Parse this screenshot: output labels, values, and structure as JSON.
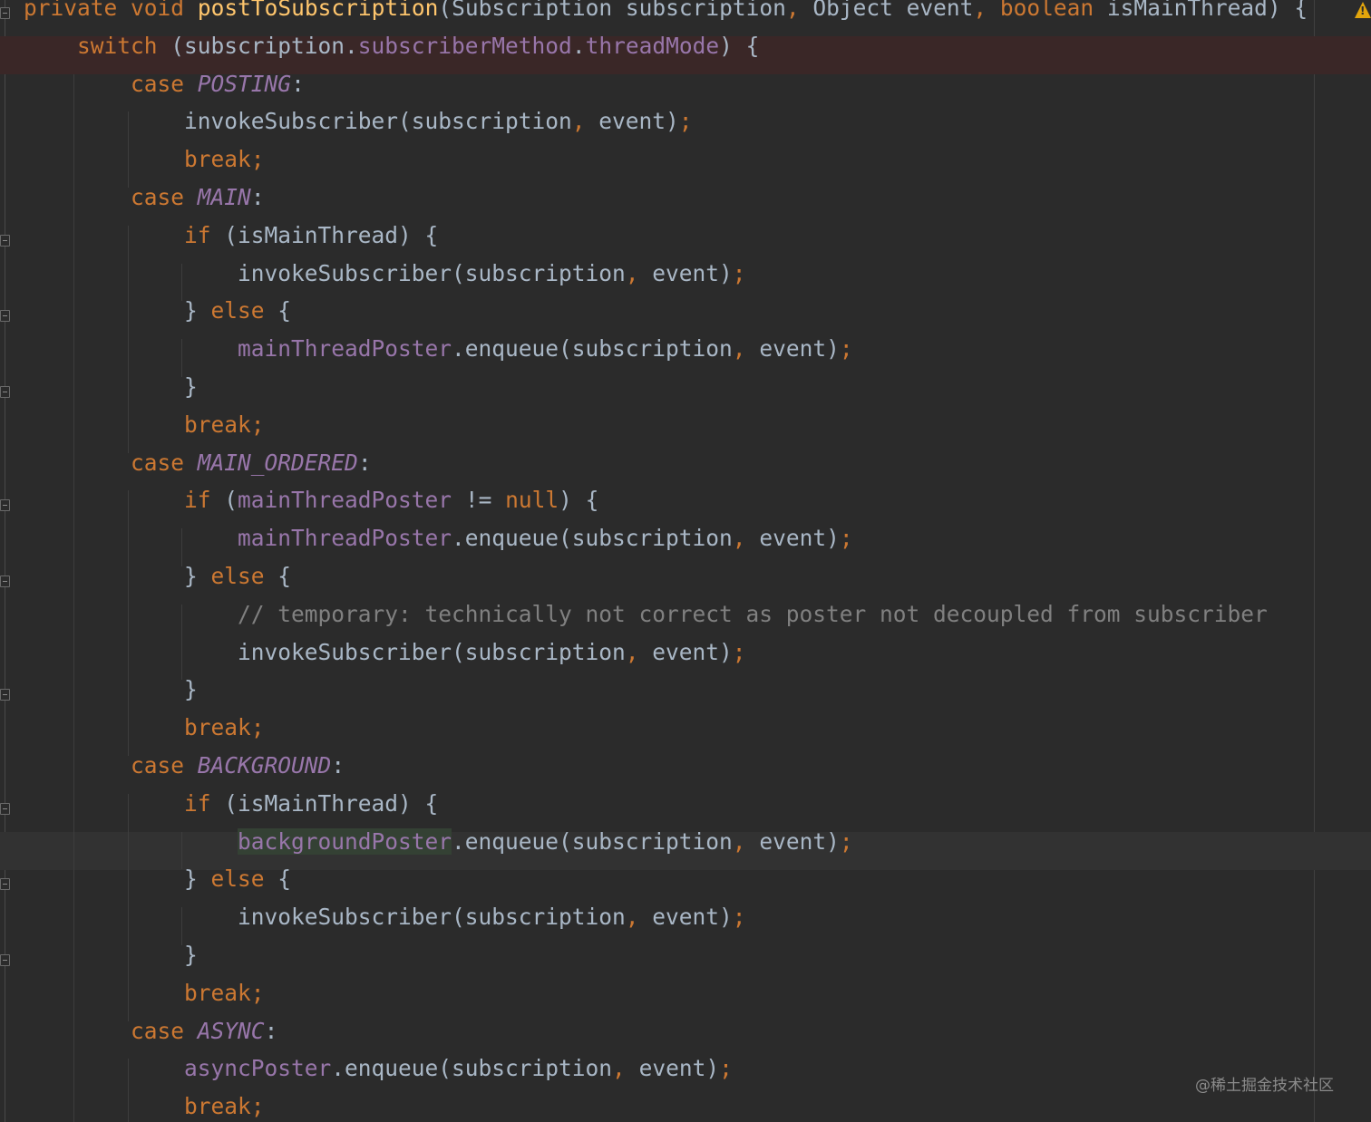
{
  "editor": {
    "language": "java",
    "theme": "darcula",
    "colors": {
      "background": "#2b2b2b",
      "keyword": "#cc7832",
      "function": "#ffc66d",
      "field": "#9876aa",
      "comment": "#808080",
      "text": "#a9b7c6",
      "error_line": "#3a2727",
      "warning": "#e2a50c"
    },
    "warning_icon": "warning-triangle-icon",
    "warning_glyph": "!",
    "watermark": "@稀土掘金技术社区",
    "lines": [
      [
        {
          "t": "kw",
          "v": "private"
        },
        {
          "t": "plain",
          "v": " "
        },
        {
          "t": "kw",
          "v": "void"
        },
        {
          "t": "plain",
          "v": " "
        },
        {
          "t": "fn",
          "v": "postToSubscription"
        },
        {
          "t": "plain",
          "v": "(Subscription subscription"
        },
        {
          "t": "punc",
          "v": ","
        },
        {
          "t": "plain",
          "v": " Object event"
        },
        {
          "t": "punc",
          "v": ","
        },
        {
          "t": "plain",
          "v": " "
        },
        {
          "t": "kw",
          "v": "boolean"
        },
        {
          "t": "plain",
          "v": " isMainThread) {"
        }
      ],
      [
        {
          "t": "plain",
          "v": "    "
        },
        {
          "t": "kw",
          "v": "switch"
        },
        {
          "t": "plain",
          "v": " (subscription."
        },
        {
          "t": "fld",
          "v": "subscriberMethod"
        },
        {
          "t": "plain",
          "v": "."
        },
        {
          "t": "fld",
          "v": "threadMode"
        },
        {
          "t": "plain",
          "v": ") {"
        }
      ],
      [
        {
          "t": "plain",
          "v": "        "
        },
        {
          "t": "kw",
          "v": "case"
        },
        {
          "t": "plain",
          "v": " "
        },
        {
          "t": "enum",
          "v": "POSTING"
        },
        {
          "t": "plain",
          "v": ":"
        }
      ],
      [
        {
          "t": "plain",
          "v": "            invokeSubscriber(subscription"
        },
        {
          "t": "punc",
          "v": ","
        },
        {
          "t": "plain",
          "v": " event)"
        },
        {
          "t": "punc",
          "v": ";"
        }
      ],
      [
        {
          "t": "plain",
          "v": "            "
        },
        {
          "t": "kw",
          "v": "break;"
        }
      ],
      [
        {
          "t": "plain",
          "v": "        "
        },
        {
          "t": "kw",
          "v": "case"
        },
        {
          "t": "plain",
          "v": " "
        },
        {
          "t": "enum",
          "v": "MAIN"
        },
        {
          "t": "plain",
          "v": ":"
        }
      ],
      [
        {
          "t": "plain",
          "v": "            "
        },
        {
          "t": "kw",
          "v": "if"
        },
        {
          "t": "plain",
          "v": " (isMainThread) {"
        }
      ],
      [
        {
          "t": "plain",
          "v": "                invokeSubscriber(subscription"
        },
        {
          "t": "punc",
          "v": ","
        },
        {
          "t": "plain",
          "v": " event)"
        },
        {
          "t": "punc",
          "v": ";"
        }
      ],
      [
        {
          "t": "plain",
          "v": "            } "
        },
        {
          "t": "kw",
          "v": "else"
        },
        {
          "t": "plain",
          "v": " {"
        }
      ],
      [
        {
          "t": "plain",
          "v": "                "
        },
        {
          "t": "fld",
          "v": "mainThreadPoster"
        },
        {
          "t": "plain",
          "v": ".enqueue(subscription"
        },
        {
          "t": "punc",
          "v": ","
        },
        {
          "t": "plain",
          "v": " event)"
        },
        {
          "t": "punc",
          "v": ";"
        }
      ],
      [
        {
          "t": "plain",
          "v": "            }"
        }
      ],
      [
        {
          "t": "plain",
          "v": "            "
        },
        {
          "t": "kw",
          "v": "break;"
        }
      ],
      [
        {
          "t": "plain",
          "v": "        "
        },
        {
          "t": "kw",
          "v": "case"
        },
        {
          "t": "plain",
          "v": " "
        },
        {
          "t": "enum",
          "v": "MAIN_ORDERED"
        },
        {
          "t": "plain",
          "v": ":"
        }
      ],
      [
        {
          "t": "plain",
          "v": "            "
        },
        {
          "t": "kw",
          "v": "if"
        },
        {
          "t": "plain",
          "v": " ("
        },
        {
          "t": "fld",
          "v": "mainThreadPoster"
        },
        {
          "t": "plain",
          "v": " != "
        },
        {
          "t": "kw",
          "v": "null"
        },
        {
          "t": "plain",
          "v": ") {"
        }
      ],
      [
        {
          "t": "plain",
          "v": "                "
        },
        {
          "t": "fld",
          "v": "mainThreadPoster"
        },
        {
          "t": "plain",
          "v": ".enqueue(subscription"
        },
        {
          "t": "punc",
          "v": ","
        },
        {
          "t": "plain",
          "v": " event)"
        },
        {
          "t": "punc",
          "v": ";"
        }
      ],
      [
        {
          "t": "plain",
          "v": "            } "
        },
        {
          "t": "kw",
          "v": "else"
        },
        {
          "t": "plain",
          "v": " {"
        }
      ],
      [
        {
          "t": "plain",
          "v": "                "
        },
        {
          "t": "cmt",
          "v": "// temporary: technically not correct as poster not decoupled from subscriber"
        }
      ],
      [
        {
          "t": "plain",
          "v": "                invokeSubscriber(subscription"
        },
        {
          "t": "punc",
          "v": ","
        },
        {
          "t": "plain",
          "v": " event)"
        },
        {
          "t": "punc",
          "v": ";"
        }
      ],
      [
        {
          "t": "plain",
          "v": "            }"
        }
      ],
      [
        {
          "t": "plain",
          "v": "            "
        },
        {
          "t": "kw",
          "v": "break;"
        }
      ],
      [
        {
          "t": "plain",
          "v": "        "
        },
        {
          "t": "kw",
          "v": "case"
        },
        {
          "t": "plain",
          "v": " "
        },
        {
          "t": "enum",
          "v": "BACKGROUND"
        },
        {
          "t": "plain",
          "v": ":"
        }
      ],
      [
        {
          "t": "plain",
          "v": "            "
        },
        {
          "t": "kw",
          "v": "if"
        },
        {
          "t": "plain",
          "v": " (isMainThread) {"
        }
      ],
      [
        {
          "t": "plain",
          "v": "                "
        },
        {
          "t": "fld",
          "v": "backgroundPoster",
          "hl": true
        },
        {
          "t": "plain",
          "v": ".enqueue(subscription"
        },
        {
          "t": "punc",
          "v": ","
        },
        {
          "t": "plain",
          "v": " event)"
        },
        {
          "t": "punc",
          "v": ";"
        }
      ],
      [
        {
          "t": "plain",
          "v": "            } "
        },
        {
          "t": "kw",
          "v": "else"
        },
        {
          "t": "plain",
          "v": " {"
        }
      ],
      [
        {
          "t": "plain",
          "v": "                invokeSubscriber(subscription"
        },
        {
          "t": "punc",
          "v": ","
        },
        {
          "t": "plain",
          "v": " event)"
        },
        {
          "t": "punc",
          "v": ";"
        }
      ],
      [
        {
          "t": "plain",
          "v": "            }"
        }
      ],
      [
        {
          "t": "plain",
          "v": "            "
        },
        {
          "t": "kw",
          "v": "break;"
        }
      ],
      [
        {
          "t": "plain",
          "v": "        "
        },
        {
          "t": "kw",
          "v": "case"
        },
        {
          "t": "plain",
          "v": " "
        },
        {
          "t": "enum",
          "v": "ASYNC"
        },
        {
          "t": "plain",
          "v": ":"
        }
      ],
      [
        {
          "t": "plain",
          "v": "            "
        },
        {
          "t": "fld",
          "v": "asyncPoster"
        },
        {
          "t": "plain",
          "v": ".enqueue(subscription"
        },
        {
          "t": "punc",
          "v": ","
        },
        {
          "t": "plain",
          "v": " event)"
        },
        {
          "t": "punc",
          "v": ";"
        }
      ],
      [
        {
          "t": "plain",
          "v": "            "
        },
        {
          "t": "kw",
          "v": "break;"
        }
      ]
    ]
  }
}
